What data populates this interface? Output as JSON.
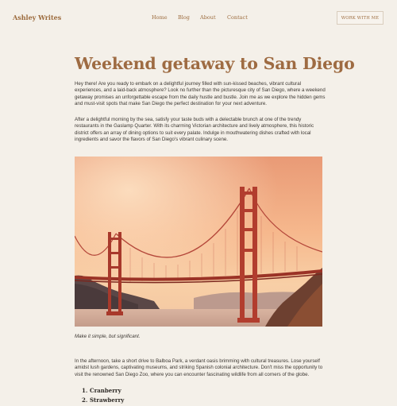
{
  "header": {
    "brand": "Ashley Writes",
    "nav": [
      {
        "label": "Home"
      },
      {
        "label": "Blog"
      },
      {
        "label": "About"
      },
      {
        "label": "Contact"
      }
    ],
    "cta_label": "WORK WITH ME"
  },
  "article": {
    "title": "Weekend getaway to San Diego",
    "paragraphs": [
      "Hey there! Are you ready to embark on a delightful journey filled with sun-kissed beaches, vibrant cultural experiences, and a laid-back atmosphere? Look no further than the picturesque city of San Diego, where a weekend getaway promises an unforgettable escape from the daily hustle and bustle. Join me as we explore the hidden gems and must-visit spots that make San Diego the perfect destination for your next adventure.",
      "After a delightful morning by the sea, satisfy your taste buds with a delectable brunch at one of the trendy restaurants in the Gaslamp Quarter. With its charming Victorian architecture and lively atmosphere, this historic district offers an array of dining options to suit every palate. Indulge in mouthwatering dishes crafted with local ingredients and savor the flavors of San Diego's vibrant culinary scene.",
      "In the afternoon, take a short drive to Balboa Park, a verdant oasis brimming with cultural treasures. Lose yourself amidst lush gardens, captivating museums, and striking Spanish colonial architecture. Don't miss the opportunity to visit the renowned San Diego Zoo, where you can encounter fascinating wildlife from all corners of the globe."
    ],
    "caption": "Make it simple, but significant.",
    "list": [
      {
        "num": "1.",
        "label": "Cranberry"
      },
      {
        "num": "2.",
        "label": "Strawberry"
      }
    ]
  },
  "colors": {
    "background": "#f4f0e9",
    "accent": "#9e6b42",
    "text": "#3d3833"
  }
}
